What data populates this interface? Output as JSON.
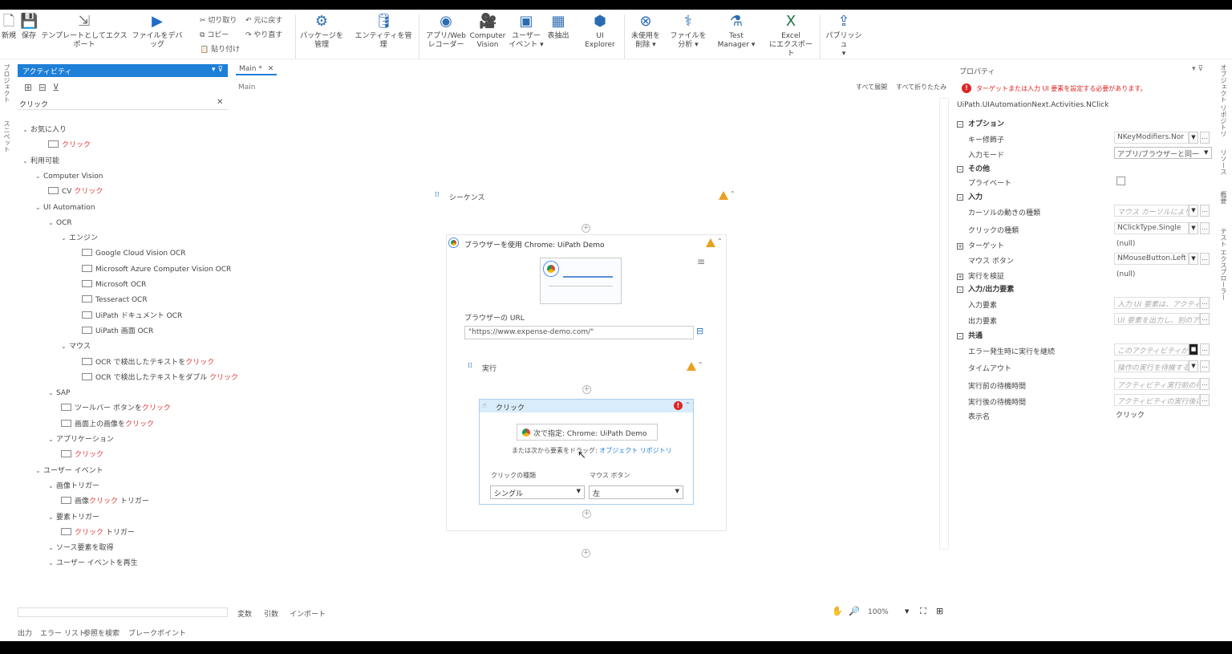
{
  "ribbon": {
    "new": "新規",
    "save": "保存",
    "export_template": "テンプレートとしてエクスポート",
    "debug_file": "ファイルをデバッグ",
    "cut": "切り取り",
    "copy": "コピー",
    "paste": "貼り付け",
    "undo": "元に戻す",
    "redo": "やり直す",
    "manage_packages_1": "パッケージを",
    "manage_packages_2": "管理",
    "manage_entities": "エンティティを管理",
    "app_web_recorder_1": "アプリ/Web",
    "app_web_recorder_2": "レコーダー",
    "computer_vision_1": "Computer",
    "computer_vision_2": "Vision",
    "user_events_1": "ユーザー",
    "user_events_2": "イベント",
    "table_extract": "表抽出",
    "ui_explorer_1": "UI",
    "ui_explorer_2": "Explorer",
    "remove_unused_1": "未使用を",
    "remove_unused_2": "削除",
    "analyze_file_1": "ファイルを",
    "analyze_file_2": "分析",
    "test_manager_1": "Test",
    "test_manager_2": "Manager",
    "excel_export_1": "Excel",
    "excel_export_2": "にエクスポート",
    "publish": "パブリッシュ"
  },
  "left_rail": {
    "project": "プロジェクト",
    "snippets": "スニペット"
  },
  "activities": {
    "panel_title": "アクティビティ",
    "search_value": "クリック",
    "tree": [
      {
        "label": "お気に入り",
        "level": 0
      },
      {
        "label": "クリック",
        "level": 2,
        "red": true
      },
      {
        "label": "利用可能",
        "level": 0
      },
      {
        "label": "Computer Vision",
        "level": 1
      },
      {
        "prefix": "CV ",
        "label": "クリック",
        "level": 2,
        "red": true
      },
      {
        "label": "UI Automation",
        "level": 1
      },
      {
        "label": "OCR",
        "level": 2
      },
      {
        "label": "エンジン",
        "level": 3
      },
      {
        "label": "Google Cloud Vision OCR",
        "level": 4
      },
      {
        "label": "Microsoft Azure Computer Vision OCR",
        "level": 4
      },
      {
        "label": "Microsoft OCR",
        "level": 4
      },
      {
        "label": "Tesseract OCR",
        "level": 4
      },
      {
        "label": "UiPath ドキュメント OCR",
        "level": 4
      },
      {
        "label": "UiPath 画面 OCR",
        "level": 4
      },
      {
        "label": "マウス",
        "level": 3
      },
      {
        "prefix": "OCR で検出したテキストを",
        "label": "クリック",
        "level": 4,
        "red": true
      },
      {
        "prefix": "OCR で検出したテキストをダブル ",
        "label": "クリック",
        "level": 4,
        "red": true
      },
      {
        "label": "SAP",
        "level": 2
      },
      {
        "prefix": "ツールバー ボタンを",
        "label": "クリック",
        "level": 3,
        "red": true
      },
      {
        "prefix": "画面上の画像を",
        "label": "クリック",
        "level": 3,
        "red": true
      },
      {
        "label": "アプリケーション",
        "level": 2
      },
      {
        "label": "クリック",
        "level": 3,
        "red": true
      },
      {
        "label": "ユーザー イベント",
        "level": 1
      },
      {
        "label": "画像トリガー",
        "level": 2
      },
      {
        "prefix": "画像",
        "label": "クリック",
        "suffix": " トリガー",
        "level": 3,
        "red": true
      },
      {
        "label": "要素トリガー",
        "level": 2
      },
      {
        "label": "クリック",
        "suffix": " トリガー",
        "level": 3,
        "red": true
      },
      {
        "label": "ソース要素を取得",
        "level": 2
      },
      {
        "label": "ユーザー イベントを再生",
        "level": 2
      }
    ]
  },
  "document": {
    "tab": "Main",
    "tab_modified": "Main *",
    "breadcrumb": "Main",
    "expand_all": "すべて展開",
    "collapse_all": "すべて折りたたみ"
  },
  "workflow": {
    "sequence": "シーケンス",
    "use_browser": "ブラウザーを使用 Chrome: UiPath Demo",
    "browser_url_label": "ブラウザーの URL",
    "browser_url": "\"https://www.expense-demo.com/\"",
    "do_label": "実行",
    "click_title": "クリック",
    "target_button": "次で指定: Chrome: UiPath Demo",
    "drag_text": "または次から要素をドラッグ: ",
    "object_repo": "オブジェクト リポジトリ",
    "click_type_label": "クリックの種類",
    "click_type_value": "シングル",
    "mouse_button_label": "マウス ボタン",
    "mouse_button_value": "左"
  },
  "bottom": {
    "variables": "変数",
    "arguments": "引数",
    "imports": "インポート",
    "zoom": "100%",
    "tabs": [
      "出力",
      "エラー リスト",
      "参照を検索",
      "ブレークポイント"
    ]
  },
  "properties": {
    "title": "プロパティ",
    "error": "ターゲットまたは入力 UI 要素を設定する必要があります。",
    "class_name": "UiPath.UIAutomationNext.Activities.NClick",
    "sections": {
      "options": "オプション",
      "misc": "その他",
      "input": "入力",
      "io": "入力/出力要素",
      "common": "共通"
    },
    "rows": {
      "key_modifiers": {
        "label": "キー修飾子",
        "value": "NKeyModifiers.Nor"
      },
      "input_mode": {
        "label": "入力モード",
        "value": "アプリ/ブラウザーと同一"
      },
      "private": {
        "label": "プライベート"
      },
      "cursor_motion": {
        "label": "カーソルの動きの種類",
        "value": "マウス カーソルによりタ"
      },
      "click_type": {
        "label": "クリックの種類",
        "value": "NClickType.Single"
      },
      "target": {
        "label": "ターゲット",
        "value": "(null)"
      },
      "mouse_button": {
        "label": "マウス ボタン",
        "value": "NMouseButton.Left"
      },
      "verify": {
        "label": "実行を検証",
        "value": "(null)"
      },
      "input_element": {
        "label": "入力要素",
        "value": "入力 UI 要素は、アクティ"
      },
      "output_element": {
        "label": "出力要素",
        "value": "UI 要素を出力し、別のア"
      },
      "continue_on_error": {
        "label": "エラー発生時に実行を継続",
        "value": "このアクティビティがエ"
      },
      "timeout": {
        "label": "タイムアウト",
        "value": "操作の実行を待機する"
      },
      "delay_before": {
        "label": "実行前の待機時間",
        "value": "アクティビティ実行前の待"
      },
      "delay_after": {
        "label": "実行後の待機時間",
        "value": "アクティビティの実行後に"
      },
      "display_name": {
        "label": "表示名",
        "value": "クリック"
      }
    }
  },
  "right_rail": {
    "object_repo": "オブジェクト リポジトリ",
    "resources": "リソース",
    "outline": "概要",
    "test_explorer": "テスト エクスプローラー"
  }
}
